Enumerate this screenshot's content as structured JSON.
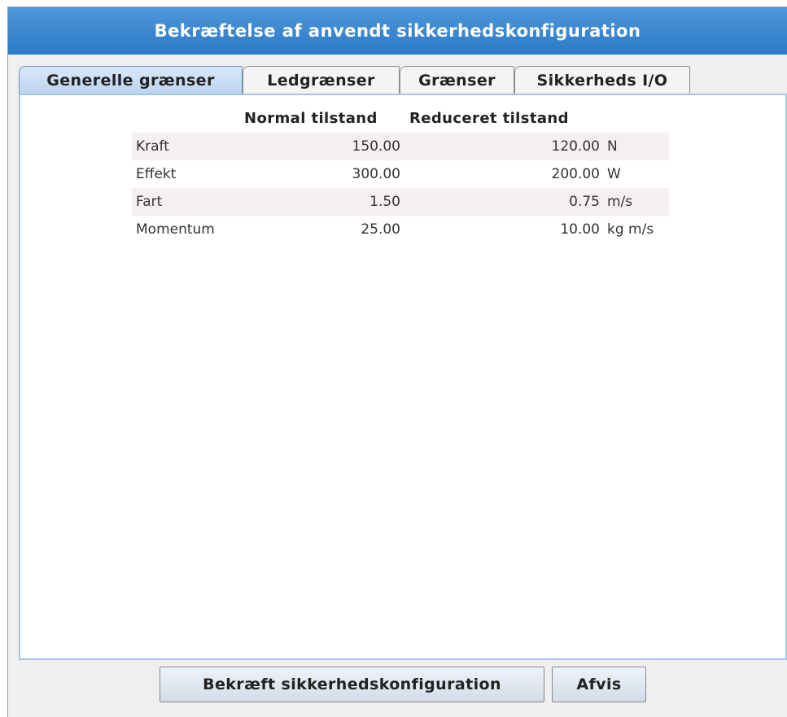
{
  "dialog": {
    "title": "Bekræftelse af anvendt sikkerhedskonfiguration"
  },
  "tabs": [
    {
      "label": "Generelle grænser",
      "active": true
    },
    {
      "label": "Ledgrænser",
      "active": false
    },
    {
      "label": "Grænser",
      "active": false
    },
    {
      "label": "Sikkerheds I/O",
      "active": false
    }
  ],
  "table": {
    "headers": {
      "normal": "Normal tilstand",
      "reduced": "Reduceret tilstand"
    },
    "rows": [
      {
        "label": "Kraft",
        "normal": "150.00",
        "reduced": "120.00",
        "unit": "N"
      },
      {
        "label": "Effekt",
        "normal": "300.00",
        "reduced": "200.00",
        "unit": "W"
      },
      {
        "label": "Fart",
        "normal": "1.50",
        "reduced": "0.75",
        "unit": "m/s"
      },
      {
        "label": "Momentum",
        "normal": "25.00",
        "reduced": "10.00",
        "unit": "kg m/s"
      }
    ]
  },
  "buttons": {
    "confirm": "Bekræft sikkerhedskonfiguration",
    "reject": "Afvis"
  },
  "colors": {
    "titlebar": "#2c79c4",
    "panel_border": "#a8c4e3",
    "row_shade": "#f6eff1"
  }
}
